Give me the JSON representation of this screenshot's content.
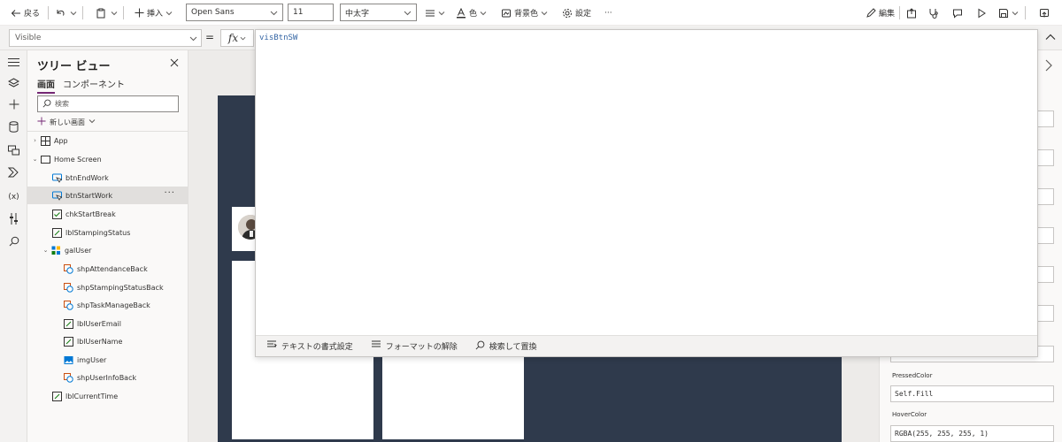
{
  "toolbar": {
    "back": "戻る",
    "insert": "挿入",
    "font": "Open Sans",
    "font_size": "11",
    "font_weight": "中太字",
    "color": "色",
    "fill": "背景色",
    "settings": "設定",
    "more": "···",
    "edit": "編集"
  },
  "formula_bar": {
    "property": "Visible",
    "equals": "=",
    "fx": "fx",
    "formula": "visBtnSW"
  },
  "editor_footer": {
    "format_text": "テキストの書式設定",
    "remove_format": "フォーマットの解除",
    "find_replace": "検索して置換"
  },
  "tree": {
    "title": "ツリー ビュー",
    "tabs": [
      "画面",
      "コンポーネント"
    ],
    "search_placeholder": "検索",
    "new_screen": "新しい画面",
    "nodes": [
      {
        "label": "App",
        "icon": "app-icon"
      },
      {
        "label": "Home Screen",
        "icon": "screen-icon"
      },
      {
        "label": "btnEndWork",
        "icon": "button-icon"
      },
      {
        "label": "btnStartWork",
        "icon": "button-icon",
        "selected": true
      },
      {
        "label": "chkStartBreak",
        "icon": "checkbox-icon"
      },
      {
        "label": "lblStampingStatus",
        "icon": "label-icon"
      },
      {
        "label": "galUser",
        "icon": "gallery-icon"
      },
      {
        "label": "shpAttendanceBack",
        "icon": "shape-icon"
      },
      {
        "label": "shpStampingStatusBack",
        "icon": "shape-icon"
      },
      {
        "label": "shpTaskManageBack",
        "icon": "shape-icon"
      },
      {
        "label": "lblUserEmail",
        "icon": "label-icon"
      },
      {
        "label": "lblUserName",
        "icon": "label-icon"
      },
      {
        "label": "imgUser",
        "icon": "image-icon"
      },
      {
        "label": "shpUserInfoBack",
        "icon": "shape-icon"
      },
      {
        "label": "lblCurrentTime",
        "icon": "label-icon"
      }
    ]
  },
  "properties": {
    "pressed_color_label": "PressedColor",
    "pressed_color_value": "Self.Fill",
    "hover_color_label": "HoverColor",
    "hover_color_value": "RGBA(255, 255, 255, 1)"
  },
  "colors": {
    "accent": "#742774",
    "app_background": "#2f3a4c",
    "formula_text": "#3465a4"
  }
}
